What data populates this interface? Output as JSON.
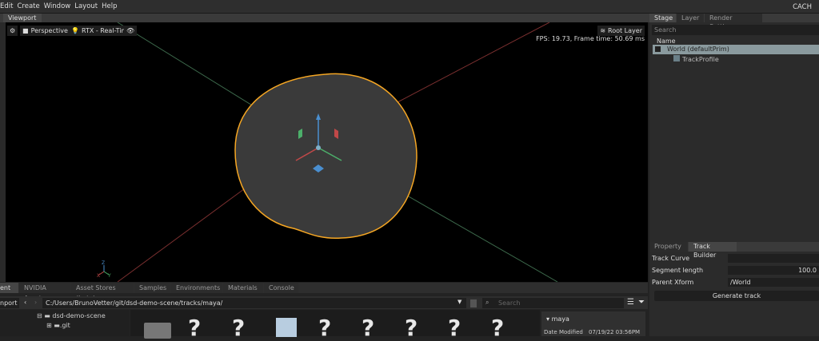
{
  "menu": {
    "items": [
      "Edit",
      "Create",
      "Window",
      "Layout",
      "Help"
    ],
    "right": "CACH"
  },
  "viewport": {
    "tab": "Viewport",
    "camera": "Perspective",
    "renderer": "RTX - Real-Time",
    "layer": "Root Layer",
    "fps": "FPS: 19.73, Frame time: 50.69 ms",
    "axis_x": "X",
    "axis_y": "Y",
    "axis_z": "Z"
  },
  "stage": {
    "tabs": [
      "Stage",
      "Layer",
      "Render Settings"
    ],
    "search_placeholder": "Search",
    "column": "Name",
    "items": [
      "World (defaultPrim)",
      "TrackProfile"
    ]
  },
  "property": {
    "tabs": [
      "Property",
      "Track Builder"
    ],
    "fields": [
      {
        "label": "Track Curve",
        "value": ""
      },
      {
        "label": "Segment length",
        "value": "100.0"
      },
      {
        "label": "Parent Xform",
        "value": "/World"
      }
    ],
    "button": "Generate track"
  },
  "content": {
    "tabs": [
      "ent",
      "NVIDIA Assets",
      "Asset Stores (beta)",
      "Samples",
      "Environments",
      "Materials",
      "Console"
    ],
    "import": "nport",
    "path": "C:/Users/BrunoVetter/git/dsd-demo-scene/tracks/maya/",
    "search_placeholder": "Search",
    "tree": [
      "dsd-demo-scene",
      ".git"
    ],
    "info_folder": "maya",
    "info_label": "Date Modified",
    "info_value": "07/19/22 03:56PM"
  },
  "colors": {
    "selection": "#f5a623",
    "accent": "#76b900"
  }
}
